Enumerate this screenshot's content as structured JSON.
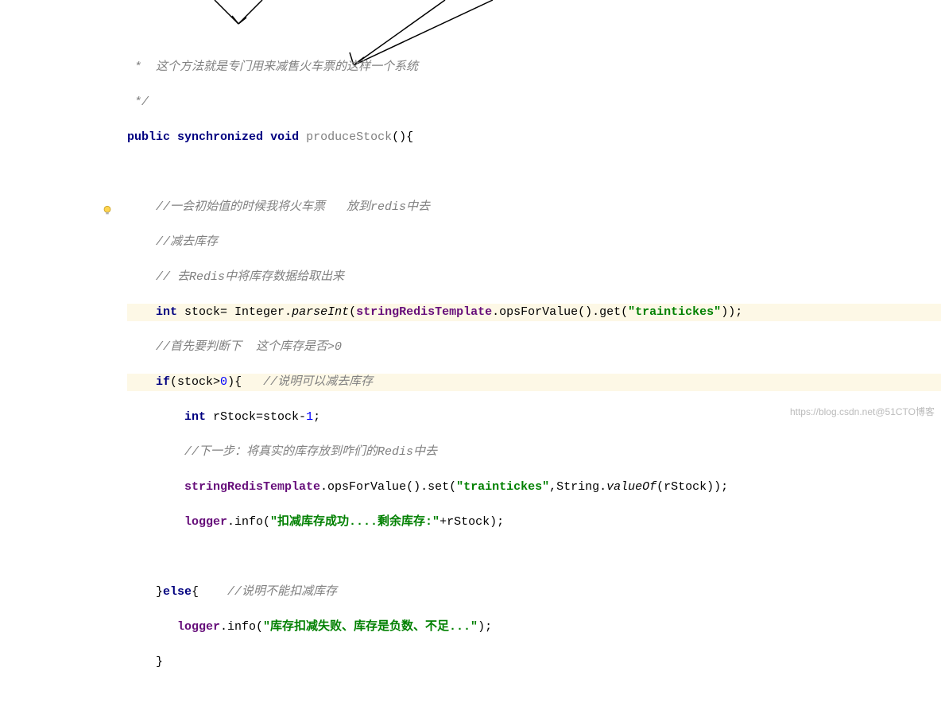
{
  "lines": {
    "l1": " *  这个方法就是专门用来减售火车票的这样一个系统",
    "l2": " */",
    "l3_kw1": "public",
    "l3_kw2": "synchronized",
    "l3_kw3": "void",
    "l3_name": "produceStock",
    "l3_tail": "(){",
    "l4": "",
    "l5": "    //一会初始值的时候我将火车票   放到redis中去",
    "l6": "    //减去库存",
    "l7": "    // 去Redis中将库存数据给取出来",
    "l8_lead": "    ",
    "l8_kw": "int",
    "l8_a": " stock= Integer.",
    "l8_parse": "parseInt",
    "l8_p1": "(",
    "l8_tmpl": "stringRedisTemplate",
    "l8_b": ".opsForValue().get(",
    "l8_str": "\"traintickes\"",
    "l8_p2": "));",
    "l9": "    //首先要判断下  这个库存是否>0",
    "l10_lead": "    ",
    "l10_if": "if",
    "l10_a": "(stock>",
    "l10_zero": "0",
    "l10_b": "){   ",
    "l10_c": "//说明可以减去库存",
    "l11_lead": "        ",
    "l11_kw": "int",
    "l11_a": " rStock=stock-",
    "l11_one": "1",
    "l11_b": ";",
    "l12": "        //下一步：将真实的库存放到咋们的Redis中去",
    "l13_lead": "        ",
    "l13_tmpl": "stringRedisTemplate",
    "l13_a": ".opsForValue().set(",
    "l13_str": "\"traintickes\"",
    "l13_b": ",String.",
    "l13_vo": "valueOf",
    "l13_c": "(rStock));",
    "l14_lead": "        ",
    "l14_log": "logger",
    "l14_a": ".info(",
    "l14_str": "\"扣减库存成功....剩余库存:\"",
    "l14_b": "+rStock);",
    "l15": "",
    "l16_lead": "    }",
    "l16_else": "else",
    "l16_a": "{    ",
    "l16_c": "//说明不能扣减库存",
    "l17_lead": "       ",
    "l17_log": "logger",
    "l17_a": ".info(",
    "l17_str": "\"库存扣减失败、库存是负数、不足...\"",
    "l17_b": ");",
    "l18": "    }"
  },
  "watermark": "https://blog.csdn.net@51CTO博客"
}
